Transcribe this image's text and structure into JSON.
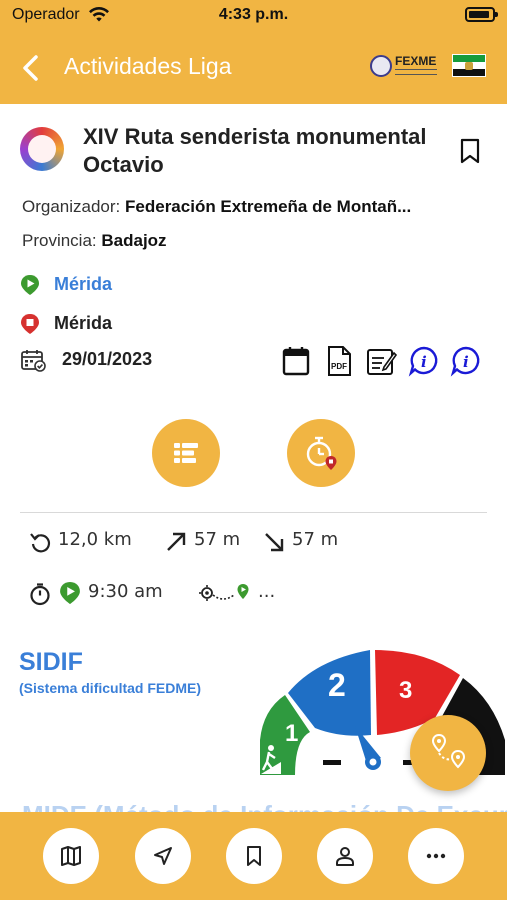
{
  "status_bar": {
    "carrier": "Operador",
    "time": "4:33 p.m."
  },
  "header": {
    "title": "Actividades Liga",
    "logo_text": "FEXME"
  },
  "event": {
    "title": "XIV Ruta  senderista monumental Octavio",
    "organizer_label": "Organizador:",
    "organizer_value": "Federación Extremeña de Montañ...",
    "province_label": "Provincia:",
    "province_value": "Badajoz",
    "start_place": "Mérida",
    "end_place": "Mérida",
    "date": "29/01/2023"
  },
  "stats": {
    "distance": "12,0 km",
    "ascent": "57 m",
    "descent": "57 m",
    "start_time": "9:30 am",
    "more": "..."
  },
  "sidif": {
    "title": "SIDIF",
    "subtitle": "(Sistema dificultad FEDME)",
    "levels": [
      "1",
      "2",
      "3"
    ],
    "selected_level": 2
  },
  "mide_peek": "MIDE (Método de Información De Excursiones)",
  "colors": {
    "accent": "#f1b543",
    "link_blue": "#3a7fd8",
    "level1_green": "#2f9a3f",
    "level2_blue": "#1f6fc5",
    "level3_red": "#e32525",
    "pin_green": "#3c9a2f",
    "pin_red": "#d6312f"
  },
  "icons": {
    "back": "chevron-left-icon",
    "bookmark": "bookmark-icon",
    "calendar": "calendar-icon",
    "pdf": "pdf-icon",
    "signup": "signup-form-icon",
    "info": "info-icon",
    "filter": "filter-list-icon",
    "timer": "stopwatch-icon",
    "fab": "route-icon",
    "tabs": [
      "map-icon",
      "navigation-icon",
      "bookmark-icon",
      "user-icon",
      "more-icon"
    ]
  }
}
